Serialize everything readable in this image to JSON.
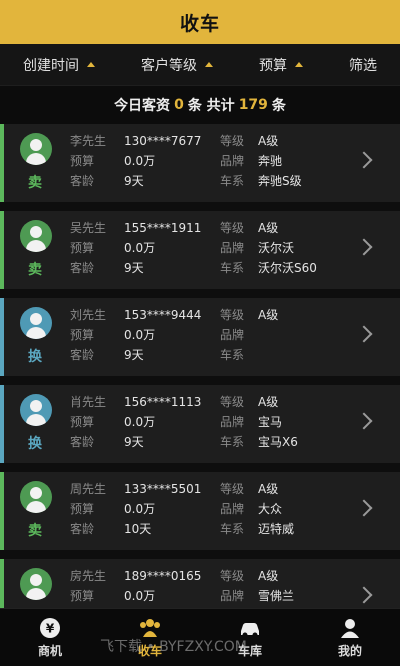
{
  "header": {
    "title": "收车"
  },
  "filters": [
    {
      "label": "创建时间"
    },
    {
      "label": "客户等级"
    },
    {
      "label": "预算"
    },
    {
      "label": "筛选"
    }
  ],
  "summary": {
    "prefix": "今日客资",
    "today_count": "0",
    "mid": "条 共计",
    "total_count": "179",
    "suffix": "条"
  },
  "labels": {
    "budget": "预算",
    "age": "客龄",
    "level": "等级",
    "brand": "品牌",
    "series": "车系"
  },
  "cards": [
    {
      "tag": "卖",
      "type": "sell",
      "name": "李先生",
      "phone": "130****7677",
      "budget": "0.0万",
      "age": "9天",
      "level": "A级",
      "brand": "奔驰",
      "series": "奔驰S级"
    },
    {
      "tag": "卖",
      "type": "sell",
      "name": "吴先生",
      "phone": "155****1911",
      "budget": "0.0万",
      "age": "9天",
      "level": "A级",
      "brand": "沃尔沃",
      "series": "沃尔沃S60"
    },
    {
      "tag": "换",
      "type": "swap",
      "name": "刘先生",
      "phone": "153****9444",
      "budget": "0.0万",
      "age": "9天",
      "level": "A级",
      "brand": "",
      "series": ""
    },
    {
      "tag": "换",
      "type": "swap",
      "name": "肖先生",
      "phone": "156****1113",
      "budget": "0.0万",
      "age": "9天",
      "level": "A级",
      "brand": "宝马",
      "series": "宝马X6"
    },
    {
      "tag": "卖",
      "type": "sell",
      "name": "周先生",
      "phone": "133****5501",
      "budget": "0.0万",
      "age": "10天",
      "level": "A级",
      "brand": "大众",
      "series": "迈特威"
    },
    {
      "tag": "",
      "type": "sell",
      "name": "房先生",
      "phone": "189****0165",
      "budget": "0.0万",
      "age": "",
      "level": "A级",
      "brand": "雪佛兰",
      "series": ""
    }
  ],
  "tabs": [
    {
      "label": "商机",
      "icon": "yen-icon",
      "active": false
    },
    {
      "label": "收车",
      "icon": "group-icon",
      "active": true
    },
    {
      "label": "车库",
      "icon": "car-icon",
      "active": false
    },
    {
      "label": "我的",
      "icon": "person-icon",
      "active": false
    }
  ],
  "watermark": "飞下载 • BYFZXY.COM",
  "colors": {
    "accent": "#e2b53c",
    "sell": "#5cb85c",
    "swap": "#5ba7c0"
  }
}
